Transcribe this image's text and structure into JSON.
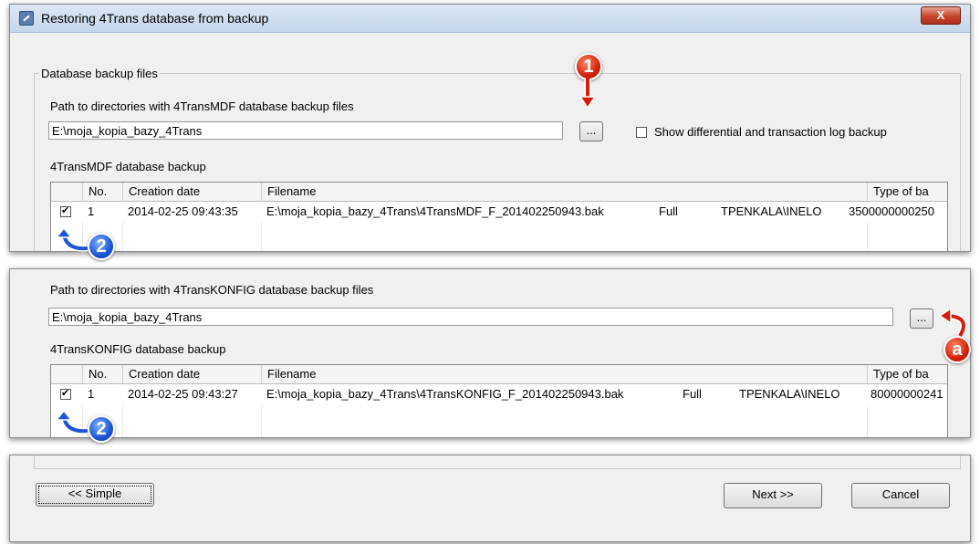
{
  "window": {
    "title": "Restoring 4Trans database from backup",
    "close_glyph": "X"
  },
  "mdf": {
    "groupbox_label": "Database backup files",
    "path_label": "Path to directories with 4TransMDF database backup files",
    "path_value": "E:\\moja_kopia_bazy_4Trans",
    "browse_label": "...",
    "show_diff_label": "Show differential and transaction log backup",
    "list_label": "4TransMDF database backup",
    "columns": [
      "No.",
      "Creation date",
      "Filename",
      "Type of ba"
    ],
    "row": {
      "no": "1",
      "date": "2014-02-25 09:43:35",
      "filename": "E:\\moja_kopia_bazy_4Trans\\4TransMDF_F_201402250943.bak",
      "type": "Full",
      "user": "TPENKALA\\INELO",
      "size": "3500000000250"
    }
  },
  "konfig": {
    "path_label": "Path to directories with 4TransKONFIG database backup files",
    "path_value": "E:\\moja_kopia_bazy_4Trans",
    "browse_label": "...",
    "list_label": "4TransKONFIG database backup",
    "columns": [
      "No.",
      "Creation date",
      "Filename",
      "Type of ba"
    ],
    "row": {
      "no": "1",
      "date": "2014-02-25 09:43:27",
      "filename": "E:\\moja_kopia_bazy_4Trans\\4TransKONFIG_F_201402250943.bak",
      "type": "Full",
      "user": "TPENKALA\\INELO",
      "size": "80000000241"
    }
  },
  "footer": {
    "simple_label": "<< Simple",
    "next_label": "Next >>",
    "cancel_label": "Cancel"
  },
  "annotations": {
    "step1": "1",
    "step2": "2",
    "stepa": "a"
  },
  "colors": {
    "annotation_red": "#d41f0a",
    "annotation_blue": "#1c55d8"
  }
}
